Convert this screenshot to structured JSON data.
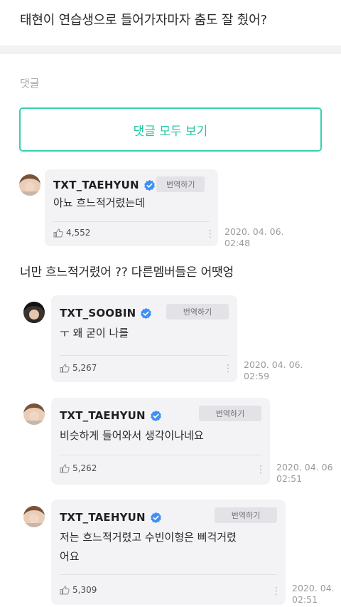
{
  "question": "태현이 연습생으로 들어가자마자 춤도 잘 췄어?",
  "section_label": "댓글",
  "view_all_label": "댓글 모두 보기",
  "reply_text": "너만 흐느적거렸어 ?? 다른멤버들은 어땟엉",
  "translate_label": "번역하기",
  "colors": {
    "accent": "#1fc79f",
    "verified": "#3d8ff7",
    "bubble": "#f3f3f6"
  },
  "comments": [
    {
      "name": "TXT_TAEHYUN",
      "text_lines": [
        "아뇨 흐느적거렸는데"
      ],
      "likes": "4,552",
      "date_line1": "2020. 04. 06.",
      "date_line2": "02:48"
    },
    {
      "name": "TXT_SOOBIN",
      "text_lines": [
        "ㅜ 왜 굳이 나를"
      ],
      "likes": "5,267",
      "date_line1": "2020. 04. 06.",
      "date_line2": "02:59"
    },
    {
      "name": "TXT_TAEHYUN",
      "text_lines": [
        "비슷하게 들어와서 생각이나네요"
      ],
      "likes": "5,262",
      "date_line1": "2020. 04. 06",
      "date_line2": "02:51"
    },
    {
      "name": "TXT_TAEHYUN",
      "text_lines": [
        "저는 흐느적거렸고 수빈이형은 삐걱거렸",
        "어요"
      ],
      "likes": "5,309",
      "date_line1": "2020. 04.",
      "date_line2": "02:51"
    }
  ]
}
